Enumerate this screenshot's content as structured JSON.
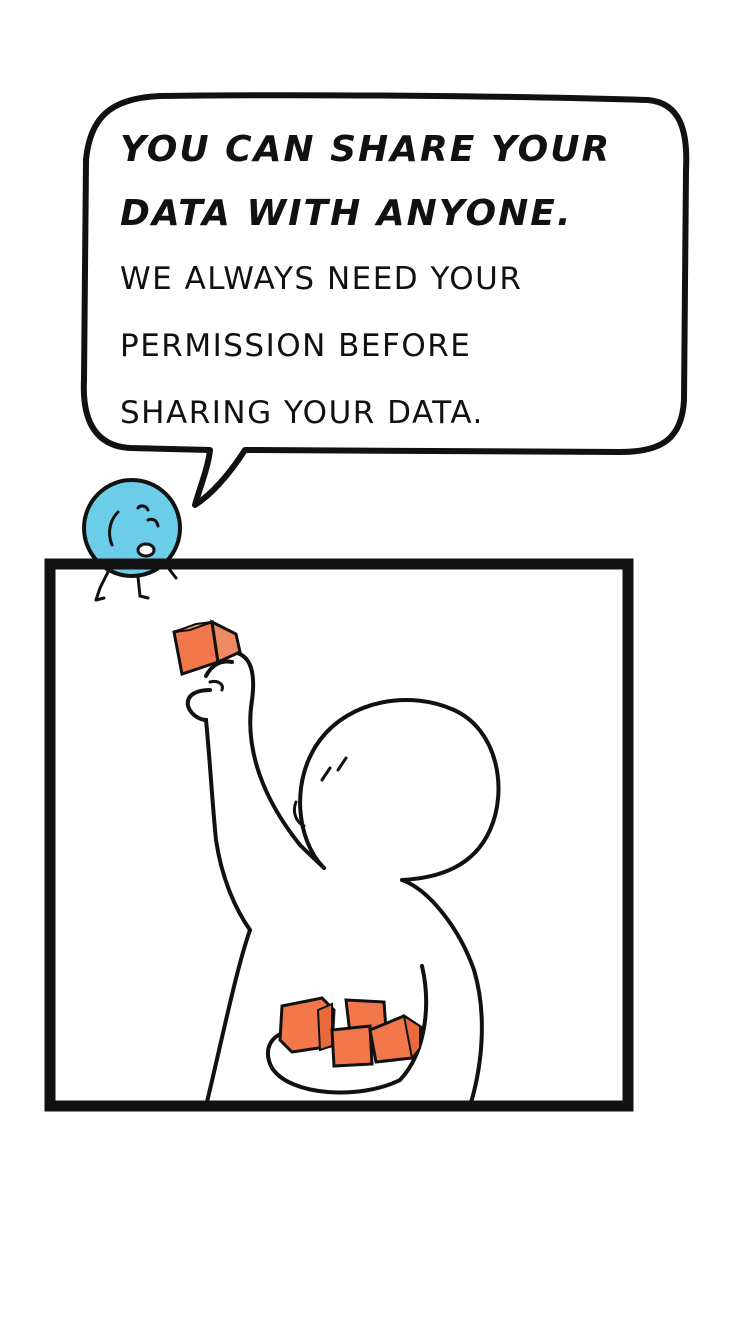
{
  "speech_bubble": {
    "headline_line_1": "YOU CAN SHARE YOUR",
    "headline_line_2": "DATA WITH ANYONE.",
    "body_line_1": "WE ALWAYS NEED YOUR",
    "body_line_2": "PERMISSION BEFORE",
    "body_line_3": "SHARING YOUR DATA."
  },
  "colors": {
    "ink": "#111111",
    "mascot_blue": "#6ccde8",
    "data_cube_orange": "#f2784b",
    "background": "#ffffff"
  },
  "icons": {
    "mascot": "blue-blob-mascot-icon",
    "person": "person-holding-cubes-icon",
    "cube": "data-cube-icon"
  }
}
